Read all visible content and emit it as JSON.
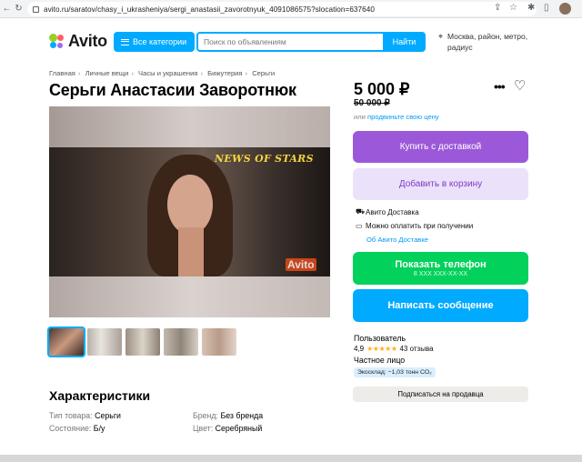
{
  "browser": {
    "url": "avito.ru/saratov/chasy_i_ukrasheniya/sergi_anastasii_zavorotnyuk_4091086575?slocation=637640"
  },
  "header": {
    "logo_text": "Avito",
    "categories_label": "Все категории",
    "search_placeholder": "Поиск по объявлениям",
    "search_button": "Найти",
    "location": "Москва, район, метро, радиус"
  },
  "breadcrumbs": [
    "Главная",
    "Личные вещи",
    "Часы и украшения",
    "Бижутерия",
    "Серьги"
  ],
  "title": "Серьги Анастасии Заворотнюк",
  "media": {
    "overlay_text": "NEWS OF STARS",
    "watermark": "Avito"
  },
  "characteristics": {
    "heading": "Характеристики",
    "items": [
      {
        "key": "Тип товара:",
        "value": "Серьги"
      },
      {
        "key": "Бренд:",
        "value": "Без бренда"
      },
      {
        "key": "Состояние:",
        "value": "Б/у"
      },
      {
        "key": "Цвет:",
        "value": "Серебряный"
      }
    ]
  },
  "pricing": {
    "price": "5 000 ₽",
    "old_price": "50 000 ₽",
    "sell_prefix": "или",
    "sell_link": "продвиньте свою цену"
  },
  "buttons": {
    "buy": "Купить с доставкой",
    "cart": "Добавить в корзину",
    "phone": "Показать телефон",
    "phone_number": "8 XXX XXX-XX-XX",
    "message": "Написать сообщение",
    "subscribe": "Подписаться на продавца"
  },
  "delivery": {
    "items": [
      "Авито Доставка",
      "Можно оплатить при получении"
    ],
    "link": "Об Авито Доставке"
  },
  "seller": {
    "name": "Пользователь",
    "rating": "4,9",
    "stars": 5,
    "reviews": "43 отзыва",
    "type": "Частное лицо",
    "eco": "Экосклад: −1,03 тонн CO₂"
  },
  "colors": {
    "accent_blue": "#00aaff",
    "buy_purple": "#9b59d9",
    "phone_green": "#02d15c"
  }
}
